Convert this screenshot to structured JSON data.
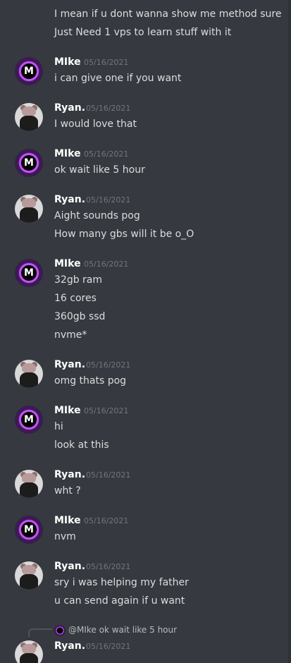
{
  "colors": {
    "background": "#36393f",
    "username": "#ffffff",
    "timestamp": "#72767d",
    "message_text": "#dcddde",
    "mike_avatar_ring": "#c84fff"
  },
  "top_messages": [
    "I mean if u dont wanna show me method sure",
    "Just Need 1 vps to learn stuff with it"
  ],
  "groups": [
    {
      "author": "MIke",
      "time": "05/16/2021",
      "avatar": "M",
      "lines": [
        "i can give one if you want"
      ]
    },
    {
      "author": "Ryan.",
      "time": "05/16/2021",
      "lines": [
        "I would love that"
      ]
    },
    {
      "author": "MIke",
      "time": "05/16/2021",
      "avatar": "M",
      "lines": [
        "ok wait like 5 hour"
      ]
    },
    {
      "author": "Ryan.",
      "time": "05/16/2021",
      "lines": [
        "Aight sounds pog",
        "How many gbs will it be o_O"
      ]
    },
    {
      "author": "MIke",
      "time": "05/16/2021",
      "avatar": "M",
      "lines": [
        "32gb ram",
        "16 cores",
        "360gb ssd",
        "nvme*"
      ]
    },
    {
      "author": "Ryan.",
      "time": "05/16/2021",
      "lines": [
        "omg thats pog"
      ]
    },
    {
      "author": "MIke",
      "time": "05/16/2021",
      "avatar": "M",
      "lines": [
        "hi",
        "look at this"
      ]
    },
    {
      "author": "Ryan.",
      "time": "05/16/2021",
      "lines": [
        "wht ?"
      ]
    },
    {
      "author": "MIke",
      "time": "05/16/2021",
      "avatar": "M",
      "lines": [
        "nvm"
      ]
    },
    {
      "author": "Ryan.",
      "time": "05/16/2021",
      "lines": [
        "sry i was helping my father",
        "u can send again if u want"
      ]
    }
  ],
  "reply": {
    "text": "@MIke ok wait like 5 hour",
    "author": "Ryan.",
    "time": "05/16/2021"
  }
}
